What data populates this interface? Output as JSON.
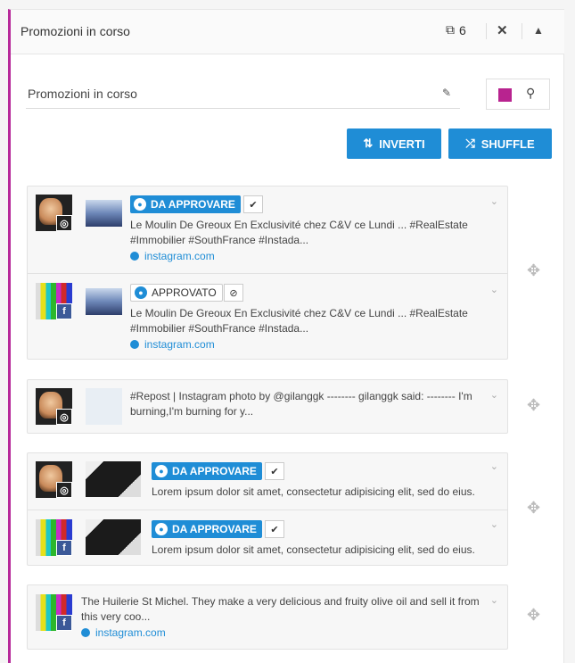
{
  "panel": {
    "title": "Promozioni in corso",
    "count": "6",
    "close_icon": "close-icon",
    "collapse_icon": "chevron-up-icon"
  },
  "name_field": {
    "value": "Promozioni in corso"
  },
  "color": {
    "swatch": "#b8238f"
  },
  "buttons": {
    "invert": "INVERTI",
    "shuffle": "SHUFFLE"
  },
  "groups": [
    {
      "rows": [
        {
          "network": "instagram",
          "status": "DA APPROVARE",
          "text_line1": "Le Moulin De Greoux En Exclusivité chez C&V ce Lundi ... #RealEstate",
          "text_line2": "#Immobilier #SouthFrance #Instada...",
          "link": "instagram.com"
        },
        {
          "network": "facebook",
          "status": "APPROVATO",
          "text_line1": "Le Moulin De Greoux En Exclusivité chez C&V ce Lundi ... #RealEstate",
          "text_line2": "#Immobilier #SouthFrance #Instada...",
          "link": "instagram.com"
        }
      ]
    },
    {
      "rows": [
        {
          "network": "instagram",
          "text_line1": "#Repost | Instagram photo by @gilanggk -------- gilanggk said: -------- I'm",
          "text_line2": "burning,I'm burning for y..."
        }
      ]
    },
    {
      "rows": [
        {
          "network": "instagram",
          "status": "DA APPROVARE",
          "text_line1": "Lorem ipsum dolor sit amet, consectetur adipisicing elit, sed do eius."
        },
        {
          "network": "facebook",
          "status": "DA APPROVARE",
          "text_line1": "Lorem ipsum dolor sit amet, consectetur adipisicing elit, sed do eius."
        }
      ]
    },
    {
      "rows": [
        {
          "network": "facebook",
          "text_line1": "The Huilerie St Michel. They make a very delicious and fruity olive oil and sell it from",
          "text_line2": "this very coo...",
          "link": "instagram.com"
        }
      ]
    }
  ]
}
